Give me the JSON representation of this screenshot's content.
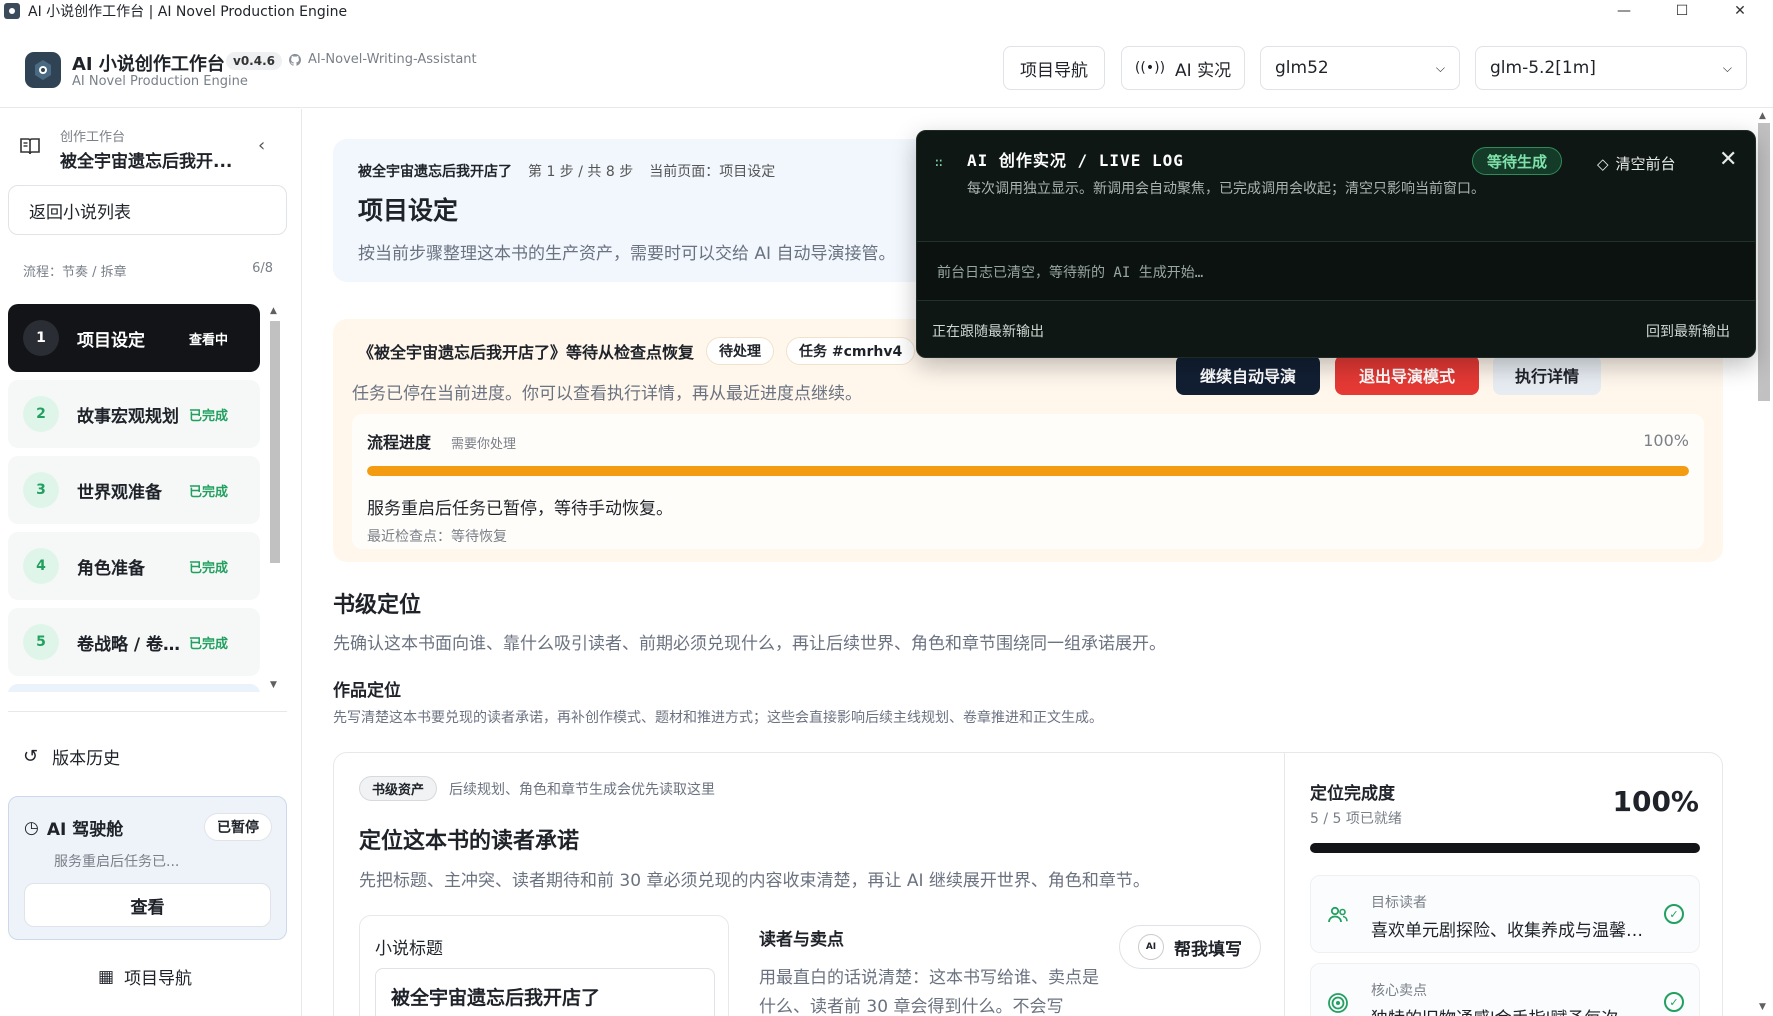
{
  "window": {
    "title": "AI 小说创作工作台 | AI Novel Production Engine",
    "minimize": "—",
    "maximize": "☐",
    "close": "✕"
  },
  "header": {
    "brand_title": "AI 小说创作工作台",
    "version": "v0.4.6",
    "repo": "AI-Novel-Writing-Assistant",
    "brand_sub": "AI Novel Production Engine",
    "project_nav": "项目导航",
    "ai_live": "AI 实况",
    "provider_select": "glm52",
    "model_select": "glm-5.2[1m]"
  },
  "sidebar": {
    "label": "创作工作台",
    "book_title": "被全宇宙遗忘后我开...",
    "back_button": "返回小说列表",
    "flow_label": "流程：节奏 / 拆章",
    "flow_count": "6/8",
    "steps": [
      {
        "num": "1",
        "name": "项目设定",
        "status": "查看中"
      },
      {
        "num": "2",
        "name": "故事宏观规划",
        "status": "已完成"
      },
      {
        "num": "3",
        "name": "世界观准备",
        "status": "已完成"
      },
      {
        "num": "4",
        "name": "角色准备",
        "status": "已完成"
      },
      {
        "num": "5",
        "name": "卷战略 / 卷骨架",
        "status": "已完成"
      }
    ],
    "history": "版本历史",
    "pilot": {
      "title": "AI 驾驶舱",
      "badge": "已暂停",
      "desc": "服务重启后任务已...",
      "view": "查看"
    },
    "bottom_nav": "项目导航"
  },
  "main": {
    "hero": {
      "book": "被全宇宙遗忘后我开店了",
      "step": "第 1 步 / 共 8 步",
      "page": "当前页面：项目设定",
      "title": "项目设定",
      "desc": "按当前步骤整理这本书的生产资产，需要时可以交给 AI 自动导演接管。"
    },
    "recover": {
      "title": "《被全宇宙遗忘后我开店了》等待从检查点恢复",
      "pending": "待处理",
      "task": "任务 #cmrhv4",
      "desc": "任务已停在当前进度。你可以查看执行详情，再从最近进度点继续。",
      "continue_btn": "继续自动导演",
      "exit_btn": "退出导演模式",
      "detail_btn": "执行详情",
      "progress_label": "流程进度",
      "progress_hint": "需要你处理",
      "progress_text": "100%",
      "progress_value": 100,
      "message": "服务重启后任务已暂停，等待手动恢复。",
      "checkpoint": "最近检查点：等待恢复"
    },
    "section": {
      "title": "书级定位",
      "desc": "先确认这本书面向谁、靠什么吸引读者、前期必须兑现什么，再让后续世界、角色和章节围绕同一组承诺展开。",
      "sub_title": "作品定位",
      "sub_desc": "先写清楚这本书要兑现的读者承诺，再补创作模式、题材和推进方式；这些会直接影响后续主线规划、卷章推进和正文生成。"
    },
    "card": {
      "tag": "书级资产",
      "tag_desc": "后续规划、角色和章节生成会优先读取这里",
      "title": "定位这本书的读者承诺",
      "desc": "先把标题、主冲突、读者期待和前 30 章必须兑现的内容收束清楚，再让 AI 继续展开世界、角色和章节。",
      "novel_title_label": "小说标题",
      "novel_title_value": "被全宇宙遗忘后我开店了",
      "reader_label": "读者与卖点",
      "reader_desc": "用最直白的话说清楚：这本书写给谁、卖点是什么、读者前 30 章会得到什么。不会写",
      "help_ai": "AI",
      "help_btn": "帮我填写",
      "completion_label": "定位完成度",
      "completion_sub": "5 / 5 项已就绪",
      "completion_pct": "100%",
      "completion_value": 100,
      "items": [
        {
          "label": "目标读者",
          "value": "喜欢单元剧探险、收集养成与温馨治愈的读者",
          "icon": "users-icon"
        },
        {
          "label": "核心卖点",
          "value": "独特的旧物通感'金手指'赋予每次",
          "icon": "target-icon"
        }
      ],
      "ok_mark": "✓"
    }
  },
  "livelog": {
    "title": "AI 创作实况 / LIVE LOG",
    "desc": "每次调用独立显示。新调用会自动聚焦，已完成调用会收起；清空只影响当前窗口。",
    "badge": "等待生成",
    "clear": "清空前台",
    "close": "✕",
    "line": "前台日志已清空，等待新的 AI 生成开始…",
    "following": "正在跟随最新输出",
    "latest": "回到最新输出"
  },
  "colors": {
    "accent_green": "#22a060",
    "progress_orange": "#f39c12",
    "danger_red": "#e53935",
    "dark": "#121417"
  }
}
